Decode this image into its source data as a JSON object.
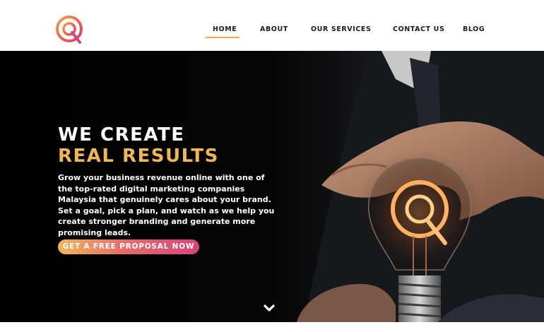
{
  "header": {
    "logo_icon": "q-search-logo-icon",
    "nav": [
      {
        "label": "HOME",
        "active": true
      },
      {
        "label": "ABOUT"
      },
      {
        "label": "OUR SERVICES"
      },
      {
        "label": "CONTACT US"
      },
      {
        "label": "BLOG"
      }
    ],
    "active_color": "#e8a94a"
  },
  "hero": {
    "headline_line1": "WE CREATE",
    "headline_line2": "REAL RESULTS",
    "description": "Grow your business revenue online with one of the top-rated digital marketing companies Malaysia that genuinely cares about your brand. Set a goal, pick a plan, and watch as we help you create stronger branding and generate more promising leads.",
    "cta_label": "GET A FREE PROPOSAL NOW",
    "scroll_icon": "chevron-down-icon",
    "accent_color": "#f0b75a"
  }
}
